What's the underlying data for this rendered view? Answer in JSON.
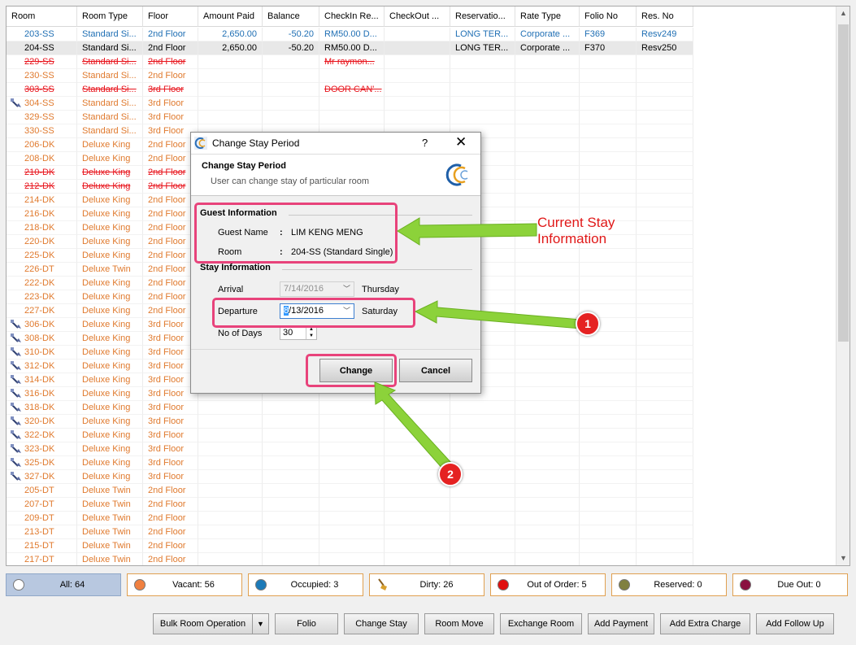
{
  "columns": [
    "Room",
    "Room Type",
    "Floor",
    "Amount Paid",
    "Balance",
    "CheckIn Re...",
    "CheckOut ...",
    "Reservatio...",
    "Rate Type",
    "Folio No",
    "Res. No"
  ],
  "rows": [
    {
      "status": "occ",
      "icon": false,
      "cells": [
        "203-SS",
        "Standard Si...",
        "2nd Floor",
        "2,650.00",
        "-50.20",
        "RM50.00 D...",
        "",
        "LONG TER...",
        "Corporate ...",
        "F369",
        "Resv249"
      ]
    },
    {
      "status": "occ2",
      "icon": false,
      "cells": [
        "204-SS",
        "Standard Si...",
        "2nd Floor",
        "2,650.00",
        "-50.20",
        "RM50.00 D...",
        "",
        "LONG TER...",
        "Corporate ...",
        "F370",
        "Resv250"
      ]
    },
    {
      "status": "ooo",
      "icon": false,
      "cells": [
        "229-SS",
        "Standard Si...",
        "2nd Floor",
        "",
        "",
        "Mr raymon...",
        "",
        "",
        "",
        "",
        ""
      ]
    },
    {
      "status": "vac",
      "icon": false,
      "cells": [
        "230-SS",
        "Standard Si...",
        "2nd Floor",
        "",
        "",
        "",
        "",
        "",
        "",
        "",
        ""
      ]
    },
    {
      "status": "ooo",
      "icon": false,
      "cells": [
        "303-SS",
        "Standard Si...",
        "3rd Floor",
        "",
        "",
        "DOOR CAN'...",
        "",
        "",
        "",
        "",
        ""
      ]
    },
    {
      "status": "vac",
      "icon": true,
      "cells": [
        "304-SS",
        "Standard Si...",
        "3rd Floor",
        "",
        "",
        "",
        "",
        "",
        "",
        "",
        ""
      ]
    },
    {
      "status": "vac",
      "icon": false,
      "cells": [
        "329-SS",
        "Standard Si...",
        "3rd Floor",
        "",
        "",
        "",
        "",
        "",
        "",
        "",
        ""
      ]
    },
    {
      "status": "vac",
      "icon": false,
      "cells": [
        "330-SS",
        "Standard Si...",
        "3rd Floor",
        "",
        "",
        "",
        "",
        "",
        "",
        "",
        ""
      ]
    },
    {
      "status": "vac",
      "icon": false,
      "cells": [
        "206-DK",
        "Deluxe King",
        "2nd Floor",
        "",
        "",
        "",
        "",
        "",
        "",
        "",
        ""
      ]
    },
    {
      "status": "vac",
      "icon": false,
      "cells": [
        "208-DK",
        "Deluxe King",
        "2nd Floor",
        "",
        "",
        "",
        "",
        "",
        "",
        "",
        ""
      ]
    },
    {
      "status": "ooo",
      "icon": false,
      "cells": [
        "210-DK",
        "Deluxe King",
        "2nd Floor",
        "",
        "",
        "",
        "",
        "",
        "",
        "",
        ""
      ]
    },
    {
      "status": "ooo",
      "icon": false,
      "cells": [
        "212-DK",
        "Deluxe King",
        "2nd Floor",
        "",
        "",
        "",
        "",
        "",
        "",
        "",
        ""
      ]
    },
    {
      "status": "vac",
      "icon": false,
      "cells": [
        "214-DK",
        "Deluxe King",
        "2nd Floor",
        "",
        "",
        "",
        "",
        "",
        "",
        "",
        ""
      ]
    },
    {
      "status": "vac",
      "icon": false,
      "cells": [
        "216-DK",
        "Deluxe King",
        "2nd Floor",
        "",
        "",
        "",
        "",
        "",
        "",
        "",
        ""
      ]
    },
    {
      "status": "vac",
      "icon": false,
      "cells": [
        "218-DK",
        "Deluxe King",
        "2nd Floor",
        "",
        "",
        "",
        "",
        "",
        "",
        "",
        ""
      ]
    },
    {
      "status": "vac",
      "icon": false,
      "cells": [
        "220-DK",
        "Deluxe King",
        "2nd Floor",
        "",
        "",
        "",
        "",
        "",
        "",
        "",
        ""
      ]
    },
    {
      "status": "vac",
      "icon": false,
      "cells": [
        "225-DK",
        "Deluxe King",
        "2nd Floor",
        "",
        "",
        "",
        "",
        "",
        "",
        "",
        ""
      ]
    },
    {
      "status": "vac",
      "icon": false,
      "cells": [
        "226-DT",
        "Deluxe Twin",
        "2nd Floor",
        "",
        "",
        "",
        "",
        "",
        "",
        "",
        ""
      ]
    },
    {
      "status": "vac",
      "icon": false,
      "cells": [
        "222-DK",
        "Deluxe King",
        "2nd Floor",
        "",
        "",
        "",
        "",
        "",
        "",
        "",
        ""
      ]
    },
    {
      "status": "vac",
      "icon": false,
      "cells": [
        "223-DK",
        "Deluxe King",
        "2nd Floor",
        "",
        "",
        "",
        "",
        "",
        "",
        "",
        ""
      ]
    },
    {
      "status": "vac",
      "icon": false,
      "cells": [
        "227-DK",
        "Deluxe King",
        "2nd Floor",
        "",
        "",
        "",
        "",
        "",
        "",
        "",
        ""
      ]
    },
    {
      "status": "vac",
      "icon": true,
      "cells": [
        "306-DK",
        "Deluxe King",
        "3rd Floor",
        "",
        "",
        "",
        "",
        "",
        "",
        "",
        ""
      ]
    },
    {
      "status": "vac",
      "icon": true,
      "cells": [
        "308-DK",
        "Deluxe King",
        "3rd Floor",
        "",
        "",
        "",
        "",
        "",
        "",
        "",
        ""
      ]
    },
    {
      "status": "vac",
      "icon": true,
      "cells": [
        "310-DK",
        "Deluxe King",
        "3rd Floor",
        "",
        "",
        "",
        "",
        "",
        "",
        "",
        ""
      ]
    },
    {
      "status": "vac",
      "icon": true,
      "cells": [
        "312-DK",
        "Deluxe King",
        "3rd Floor",
        "",
        "",
        "",
        "",
        "",
        "",
        "",
        ""
      ]
    },
    {
      "status": "vac",
      "icon": true,
      "cells": [
        "314-DK",
        "Deluxe King",
        "3rd Floor",
        "",
        "",
        "",
        "",
        "",
        "",
        "",
        ""
      ]
    },
    {
      "status": "vac",
      "icon": true,
      "cells": [
        "316-DK",
        "Deluxe King",
        "3rd Floor",
        "",
        "",
        "",
        "",
        "",
        "",
        "",
        ""
      ]
    },
    {
      "status": "vac",
      "icon": true,
      "cells": [
        "318-DK",
        "Deluxe King",
        "3rd Floor",
        "",
        "",
        "",
        "",
        "",
        "",
        "",
        ""
      ]
    },
    {
      "status": "vac",
      "icon": true,
      "cells": [
        "320-DK",
        "Deluxe King",
        "3rd Floor",
        "",
        "",
        "",
        "",
        "",
        "",
        "",
        ""
      ]
    },
    {
      "status": "vac",
      "icon": true,
      "cells": [
        "322-DK",
        "Deluxe King",
        "3rd Floor",
        "",
        "",
        "",
        "",
        "",
        "",
        "",
        ""
      ]
    },
    {
      "status": "vac",
      "icon": true,
      "cells": [
        "323-DK",
        "Deluxe King",
        "3rd Floor",
        "",
        "",
        "",
        "",
        "",
        "",
        "",
        ""
      ]
    },
    {
      "status": "vac",
      "icon": true,
      "cells": [
        "325-DK",
        "Deluxe King",
        "3rd Floor",
        "",
        "",
        "",
        "",
        "",
        "",
        "",
        ""
      ]
    },
    {
      "status": "vac",
      "icon": true,
      "cells": [
        "327-DK",
        "Deluxe King",
        "3rd Floor",
        "",
        "",
        "",
        "",
        "",
        "",
        "",
        ""
      ]
    },
    {
      "status": "vac",
      "icon": false,
      "cells": [
        "205-DT",
        "Deluxe Twin",
        "2nd Floor",
        "",
        "",
        "",
        "",
        "",
        "",
        "",
        ""
      ]
    },
    {
      "status": "vac",
      "icon": false,
      "cells": [
        "207-DT",
        "Deluxe Twin",
        "2nd Floor",
        "",
        "",
        "",
        "",
        "",
        "",
        "",
        ""
      ]
    },
    {
      "status": "vac",
      "icon": false,
      "cells": [
        "209-DT",
        "Deluxe Twin",
        "2nd Floor",
        "",
        "",
        "",
        "",
        "",
        "",
        "",
        ""
      ]
    },
    {
      "status": "vac",
      "icon": false,
      "cells": [
        "213-DT",
        "Deluxe Twin",
        "2nd Floor",
        "",
        "",
        "",
        "",
        "",
        "",
        "",
        ""
      ]
    },
    {
      "status": "vac",
      "icon": false,
      "cells": [
        "215-DT",
        "Deluxe Twin",
        "2nd Floor",
        "",
        "",
        "",
        "",
        "",
        "",
        "",
        ""
      ]
    },
    {
      "status": "vac",
      "icon": false,
      "cells": [
        "217-DT",
        "Deluxe Twin",
        "2nd Floor",
        "",
        "",
        "",
        "",
        "",
        "",
        "",
        ""
      ]
    }
  ],
  "status_filters": [
    {
      "label": "All: 64",
      "color": "#ffffff",
      "active": true,
      "icon": "circle-icon"
    },
    {
      "label": "Vacant: 56",
      "color": "#f08040",
      "active": false,
      "icon": "circle-icon"
    },
    {
      "label": "Occupied: 3",
      "color": "#1c7ab8",
      "active": false,
      "icon": "circle-icon"
    },
    {
      "label": "Dirty: 26",
      "color": "#d8a030",
      "active": false,
      "icon": "broom-icon"
    },
    {
      "label": "Out of Order: 5",
      "color": "#e01010",
      "active": false,
      "icon": "circle-icon"
    },
    {
      "label": "Reserved: 0",
      "color": "#808040",
      "active": false,
      "icon": "circle-icon"
    },
    {
      "label": "Due Out: 0",
      "color": "#8a1040",
      "active": false,
      "icon": "circle-icon"
    }
  ],
  "actions": {
    "bulk": "Bulk Room Operation",
    "folio": "Folio",
    "change_stay": "Change Stay",
    "room_move": "Room Move",
    "exchange_room": "Exchange Room",
    "add_payment": "Add Payment",
    "add_extra_charge": "Add Extra Charge",
    "add_follow_up": "Add Follow Up"
  },
  "dialog": {
    "title": "Change Stay Period",
    "help": "?",
    "close": "✕",
    "header_title": "Change Stay Period",
    "header_sub": "User can change stay of particular room",
    "guest_section": "Guest Information",
    "guest_name_label": "Guest Name",
    "guest_name": "LIM KENG MENG",
    "room_label": "Room",
    "room": "204-SS (Standard Single)",
    "colon": ":",
    "stay_section": "Stay Information",
    "arrival_label": "Arrival",
    "arrival": "7/14/2016",
    "arrival_day": "Thursday",
    "departure_label": "Departure",
    "departure_sel": "8",
    "departure_rest": "/13/2016",
    "departure_day": "Saturday",
    "days_label": "No of Days",
    "days": "30",
    "change": "Change",
    "cancel": "Cancel"
  },
  "annotations": {
    "current_line1": "Current Stay",
    "current_line2": "Information",
    "badge1": "1",
    "badge2": "2"
  }
}
